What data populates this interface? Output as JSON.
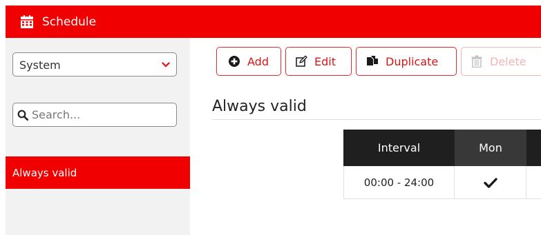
{
  "header": {
    "title": "Schedule",
    "icon": "calendar-icon",
    "color": "#f00000"
  },
  "sidebar": {
    "select": {
      "value": "System",
      "icon": "chevron-down-icon"
    },
    "search": {
      "placeholder": "Search...",
      "value": "",
      "icon": "search-icon"
    },
    "items": [
      {
        "label": "Always valid",
        "active": true
      }
    ]
  },
  "toolbar": {
    "buttons": [
      {
        "label": "Add",
        "icon": "plus-circle-icon",
        "enabled": true
      },
      {
        "label": "Edit",
        "icon": "edit-icon",
        "enabled": true
      },
      {
        "label": "Duplicate",
        "icon": "copy-icon",
        "enabled": true
      },
      {
        "label": "Delete",
        "icon": "trash-icon",
        "enabled": false
      }
    ]
  },
  "main": {
    "title": "Always valid",
    "table": {
      "columns": [
        "Interval",
        "Mon"
      ],
      "rows": [
        {
          "interval": "00:00 - 24:00",
          "mon": "checkmark-icon"
        }
      ]
    }
  }
}
